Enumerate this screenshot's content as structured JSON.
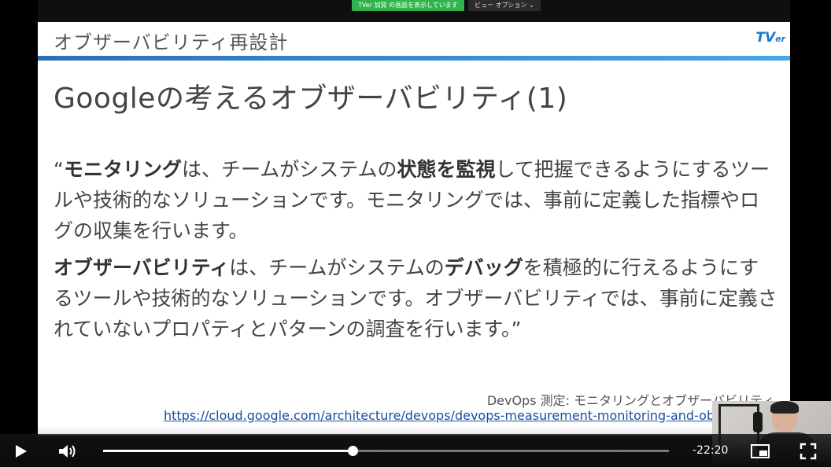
{
  "share_bar": {
    "badge": "TVer 加賀 の画面を表示しています",
    "view_options": "ビュー オプション ⌄"
  },
  "slide": {
    "header_title": "オブザーバビリティ再設計",
    "logo_main": "TV",
    "logo_sub": "er",
    "main_title": "Googleの考えるオブザーバビリティ(1)",
    "para1": {
      "q": "“",
      "b1": "モニタリング",
      "t1": "は、チームがシステムの",
      "b2": "状態を監視",
      "t2": "して把握できるようにするツールや技術的なソリューションです。モニタリングでは、事前に定義した指標やログの収集を行います。"
    },
    "para2": {
      "b1": "オブザーバビリティ",
      "t1": "は、チームがシステムの",
      "b2": "デバッグ",
      "t2": "を積極的に行えるようにするツールや技術的なソリューションです。オブザーバビリティでは、事前に定義されていないプロパティとパターンの調査を行います。",
      "q": "”"
    },
    "source_text": "DevOps 測定: モニタリングとオブザーバビリティ",
    "source_link": "https://cloud.google.com/architecture/devops/devops-measurement-monitoring-and-ob"
  },
  "player": {
    "progress_fraction": 0.441,
    "time_remaining": "-22:20",
    "icons": {
      "play": "play-icon",
      "volume": "volume-icon",
      "pip": "picture-in-picture-icon",
      "fullscreen": "fullscreen-icon"
    }
  }
}
